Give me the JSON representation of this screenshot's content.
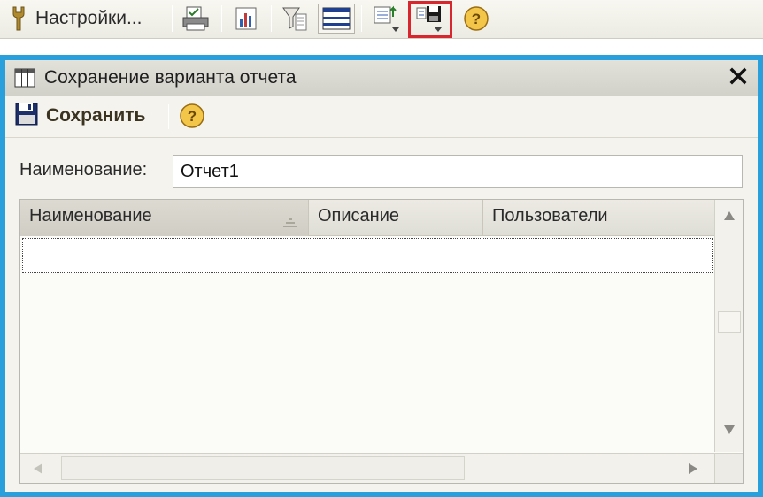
{
  "toolbar": {
    "settings_label": "Настройки...",
    "buttons": [
      "wrench-icon",
      "print-check-icon",
      "chart-icon",
      "filter-icon",
      "table-icon",
      "load-variant-icon",
      "save-variant-icon",
      "help-icon"
    ],
    "highlight_color": "#d8262e"
  },
  "dialog": {
    "title": "Сохранение варианта отчета",
    "save_label": "Сохранить",
    "name_label": "Наименование:",
    "name_value": "Отчет1",
    "frame_color": "#29a0dc"
  },
  "table": {
    "columns": [
      "Наименование",
      "Описание",
      "Пользователи"
    ],
    "rows": []
  }
}
